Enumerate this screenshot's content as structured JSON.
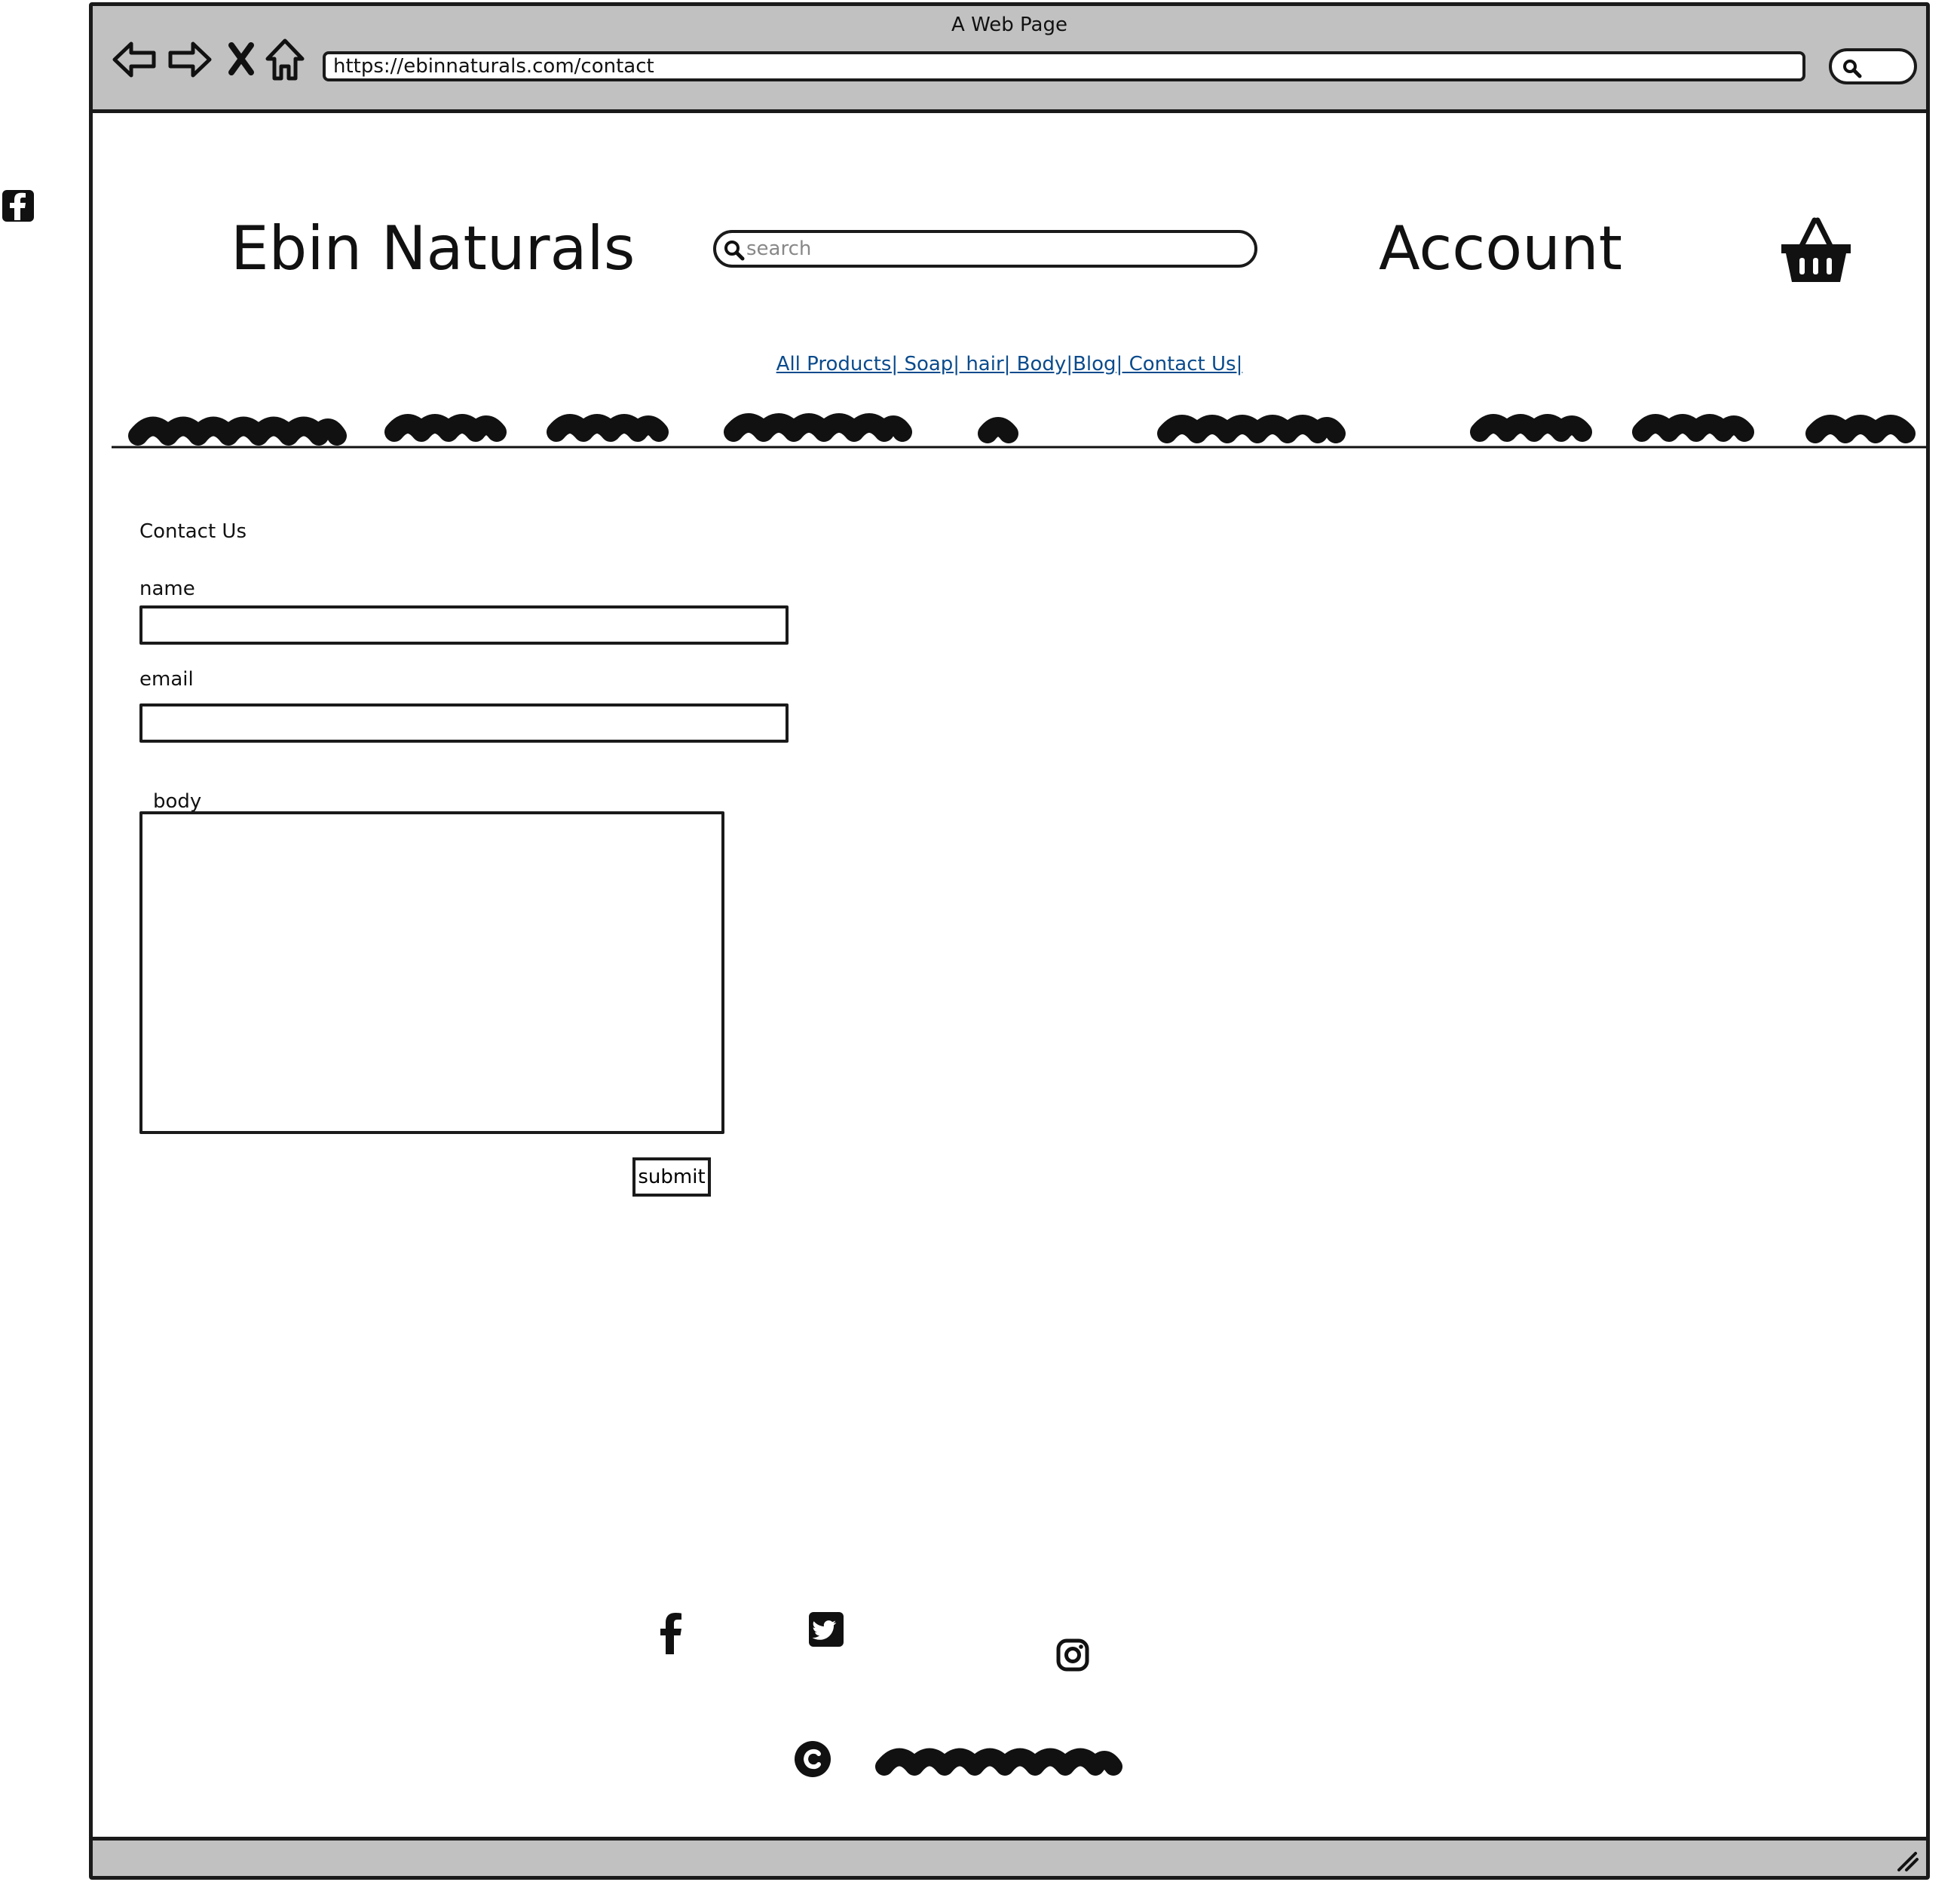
{
  "browser": {
    "window_title": "A Web Page",
    "url": "https://ebinnaturals.com/contact"
  },
  "header": {
    "site_title": "Ebin Naturals",
    "search_placeholder": "search",
    "account_label": "Account"
  },
  "nav": {
    "links_text": "All Products| Soap| hair| Body|Blog| Contact Us|"
  },
  "contact_form": {
    "heading": "Contact Us",
    "name_label": "name",
    "email_label": "email",
    "body_label": "body",
    "submit_label": "submit"
  },
  "icons": {
    "outer": "facebook-square-icon",
    "cart": "shopping-basket-icon",
    "social": [
      "facebook-icon",
      "twitter-icon",
      "instagram-icon"
    ],
    "copyright": "copyright-icon"
  }
}
